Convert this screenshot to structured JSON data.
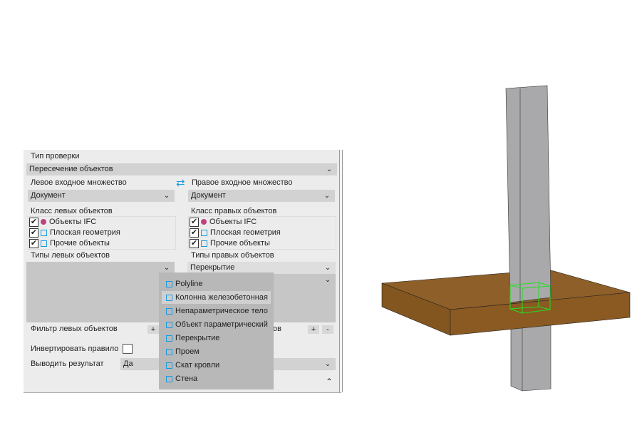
{
  "check_type": {
    "label": "Тип проверки",
    "value": "Пересечение объектов"
  },
  "left": {
    "set_label": "Левое входное множество",
    "set_value": "Документ",
    "class_label": "Класс левых объектов",
    "types_label": "Типы левых объектов",
    "types_value": "",
    "filter_label": "Фильтр левых объектов"
  },
  "right": {
    "set_label": "Правое входное множество",
    "set_value": "Документ",
    "class_label": "Класс правых объектов",
    "types_label": "Типы правых объектов",
    "types_value": "Перекрытие",
    "filter_label_partial": "ов"
  },
  "classes": [
    {
      "label": "Объекты IFC",
      "checked": true,
      "icon": "ifc-icon"
    },
    {
      "label": "Плоская геометрия",
      "checked": true,
      "icon": "flat-geometry-icon"
    },
    {
      "label": "Прочие объекты",
      "checked": true,
      "icon": "other-objects-icon"
    }
  ],
  "invert": {
    "label": "Инвертировать правило",
    "checked": false
  },
  "output": {
    "label": "Выводить результат",
    "value": "Да"
  },
  "buttons": {
    "plus": "+",
    "minus": "-"
  },
  "dropdown": {
    "items": [
      "Polyline",
      "Колонна железобетонная",
      "Непараметрическое тело",
      "Объект параметрический",
      "Перекрытие",
      "Проем",
      "Скат кровли",
      "Стена"
    ],
    "hovered": "Колонна железобетонная"
  },
  "colors": {
    "slab": "#8a5a22",
    "column": "#a9a9ab",
    "selection": "#22e022",
    "accent": "#1a9be0"
  }
}
